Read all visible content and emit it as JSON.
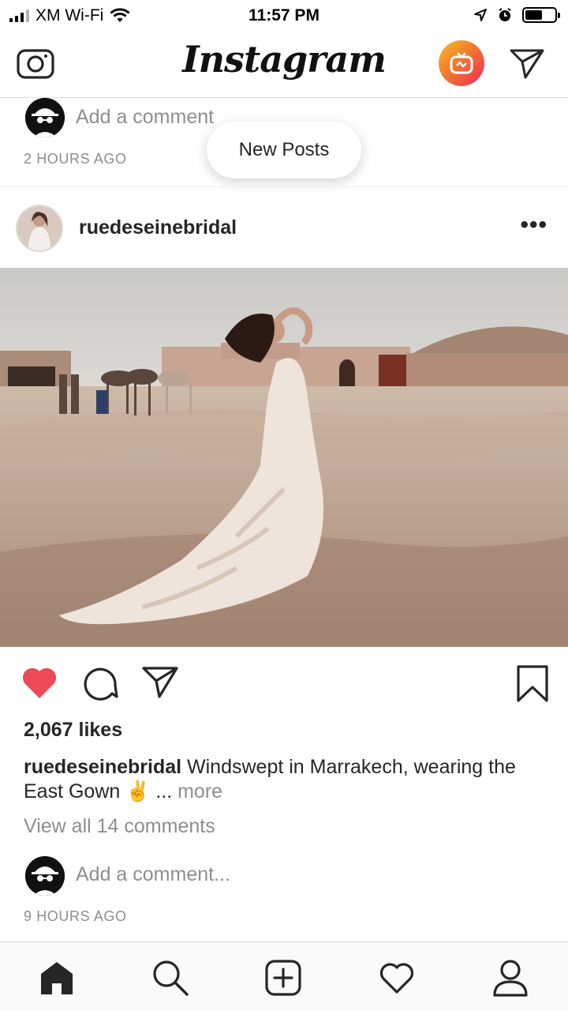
{
  "status_bar": {
    "carrier": "XM Wi-Fi",
    "time": "11:57 PM",
    "battery_level": 0.58
  },
  "header": {
    "logo_text": "Instagram",
    "camera_icon": "camera-icon",
    "igtv_icon": "igtv-icon",
    "direct_icon": "paper-plane-icon"
  },
  "previous_post": {
    "add_comment_placeholder": "Add a comment",
    "timestamp": "2 HOURS AGO"
  },
  "new_posts_pill": {
    "label": "New Posts"
  },
  "post": {
    "username": "ruedeseinebridal",
    "more_label": "•••",
    "liked": true,
    "likes": "2,067 likes",
    "caption_user": "ruedeseinebridal",
    "caption_text": "Windswept in Marrakech, wearing the East Gown",
    "caption_emoji": "✌️",
    "caption_ellipsis": " ... ",
    "caption_more": "more",
    "view_comments": "View all 14 comments",
    "add_comment_placeholder": "Add a comment...",
    "timestamp": "9 HOURS AGO"
  },
  "colors": {
    "like_red": "#ed4956",
    "secondary_text": "#8e8e8e",
    "primary_text": "#262626"
  },
  "tabbar": {
    "items": [
      "home-icon",
      "search-icon",
      "add-post-icon",
      "activity-heart-icon",
      "profile-icon"
    ],
    "active": "home-icon"
  }
}
